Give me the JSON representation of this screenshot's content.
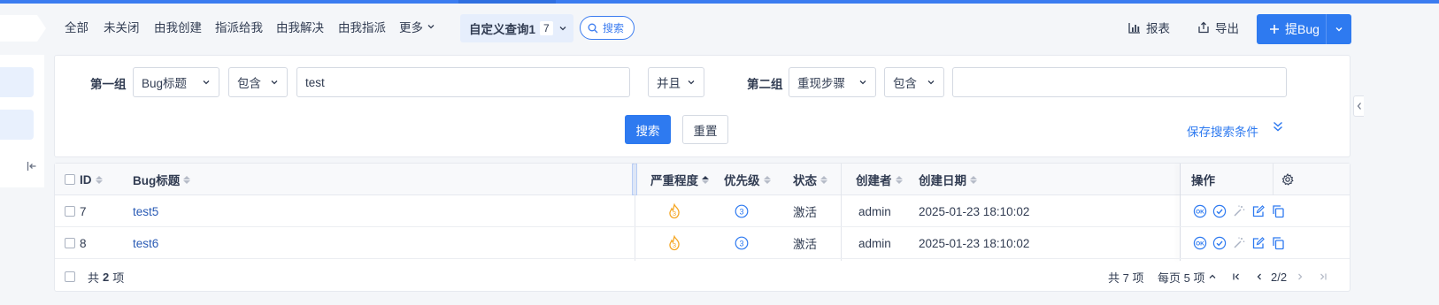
{
  "nav": {
    "tabs": [
      "全部",
      "未关闭",
      "由我创建",
      "指派给我",
      "由我解决",
      "由我指派"
    ],
    "more": "更多",
    "active_query": "自定义查询1",
    "active_count": "7",
    "search": "搜索",
    "report": "报表",
    "export": "导出",
    "add_bug": "提Bug"
  },
  "search_panel": {
    "group1_label": "第一组",
    "group1_field": "Bug标题",
    "group1_operator": "包含",
    "group1_value": "test",
    "logic": "并且",
    "group2_label": "第二组",
    "group2_field": "重现步骤",
    "group2_operator": "包含",
    "group2_value": "",
    "search_button": "搜索",
    "reset_button": "重置",
    "save_link": "保存搜索条件"
  },
  "table": {
    "headers": {
      "id": "ID",
      "title": "Bug标题",
      "severity": "严重程度",
      "priority": "优先级",
      "status": "状态",
      "creator": "创建者",
      "date": "创建日期",
      "actions": "操作"
    },
    "rows": [
      {
        "id": "7",
        "title": "test5",
        "severity": "3",
        "priority": "3",
        "status": "激活",
        "creator": "admin",
        "date": "2025-01-23 18:10:02"
      },
      {
        "id": "8",
        "title": "test6",
        "severity": "3",
        "priority": "3",
        "status": "激活",
        "creator": "admin",
        "date": "2025-01-23 18:10:02"
      }
    ],
    "footer": {
      "total_prefix": "共",
      "total_count": "2",
      "total_suffix": "项",
      "all_total": "共 7 项",
      "per_page": "每页 5 项",
      "page": "2/2"
    }
  },
  "colors": {
    "accent": "#2e7af0",
    "severity": "#f5a623",
    "link": "#2a5bb5"
  }
}
